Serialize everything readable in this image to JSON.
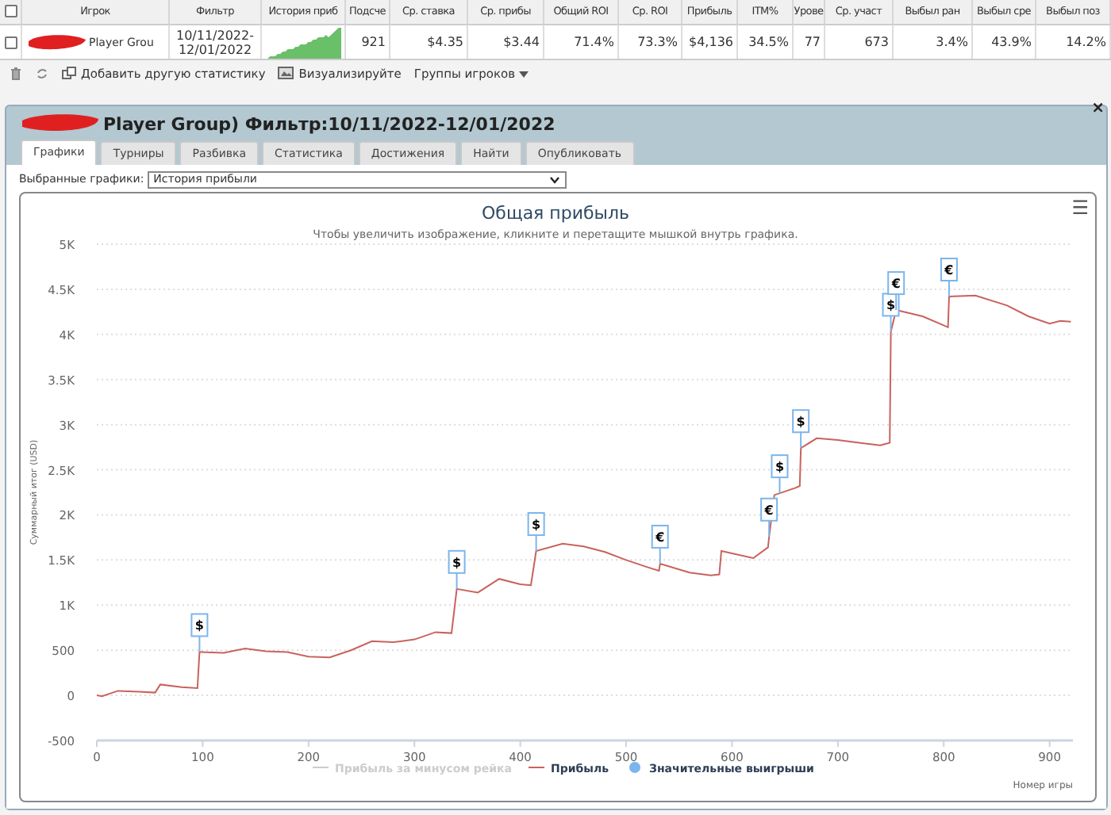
{
  "table": {
    "columns": [
      "Игрок",
      "Фильтр",
      "История приб",
      "Подсче",
      "Ср. ставка",
      "Ср. прибы",
      "Общий ROI",
      "Ср. ROI",
      "Прибыль",
      "ITM%",
      "Урове",
      "Ср. участ",
      "Выбыл ран",
      "Выбыл сре",
      "Выбыл поз"
    ],
    "header_checked": false,
    "rows": [
      {
        "checked": false,
        "cells": [
          "Player Grou",
          "10/11/2022-12/01/2022",
          null,
          "921",
          "$4.35",
          "$3.44",
          "71.4%",
          "73.3%",
          "$4,136",
          "34.5%",
          "77",
          "673",
          "3.4%",
          "43.9%",
          "14.2%"
        ]
      }
    ]
  },
  "toolbar": [
    {
      "kind": "delete"
    },
    {
      "kind": "refresh"
    },
    {
      "kind": "add",
      "label": "Добавить другую статистику"
    },
    {
      "kind": "visualize",
      "label": "Визуализируйте"
    },
    {
      "kind": "dropdown",
      "label": "Группы игроков"
    }
  ],
  "panel": {
    "title": "Player Group) Фильтр:10/11/2022-12/01/2022",
    "close": "×",
    "tabs": [
      {
        "label": "Графики",
        "selected": true
      },
      {
        "label": "Турниры",
        "selected": false
      },
      {
        "label": "Разбивка",
        "selected": false
      },
      {
        "label": "Статистика",
        "selected": false
      },
      {
        "label": "Достижения",
        "selected": false
      },
      {
        "label": "Найти",
        "selected": false
      },
      {
        "label": "Опубликовать",
        "selected": false
      }
    ],
    "chart_select": {
      "label": "Выбранные графики:",
      "value": "История прибыли"
    },
    "chart": {
      "menu": "☰",
      "legend": [
        {
          "label": "Прибыль за минусом рейка",
          "kind": "line",
          "hidden": true
        },
        {
          "kind": "series"
        },
        {
          "label": "Значительные выигрыши",
          "kind": "dot",
          "hidden": false
        }
      ],
      "chart_data": {
        "type": "line",
        "title": "Общая прибыль",
        "subtitle": "Чтобы увеличить изображение, кликните и перетащите мышкой внутрь графика.",
        "xlabel": "Номер игры",
        "ylabel": "Суммарный итог (USD)",
        "x": [
          0,
          5,
          20,
          40,
          55,
          60,
          80,
          95,
          97,
          120,
          140,
          160,
          180,
          200,
          220,
          240,
          260,
          280,
          300,
          320,
          335,
          340,
          360,
          380,
          400,
          410,
          415,
          440,
          460,
          480,
          500,
          520,
          531,
          532,
          560,
          580,
          588,
          590,
          620,
          634,
          635,
          640,
          660,
          664,
          665,
          680,
          700,
          720,
          740,
          749,
          750,
          755,
          780,
          800,
          804,
          805,
          830,
          860,
          880,
          900,
          910,
          920
        ],
        "series": [
          {
            "name": "Прибыль",
            "color": "#c9625c",
            "values": [
              0,
              -10,
              50,
              40,
              30,
              120,
              90,
              80,
              480,
              470,
              520,
              490,
              480,
              430,
              420,
              500,
              600,
              590,
              620,
              700,
              690,
              1180,
              1140,
              1290,
              1230,
              1220,
              1600,
              1680,
              1650,
              1590,
              1500,
              1420,
              1380,
              1460,
              1360,
              1330,
              1340,
              1600,
              1520,
              1640,
              1760,
              2220,
              2300,
              2320,
              2740,
              2850,
              2830,
              2800,
              2770,
              2800,
              4030,
              4270,
              4200,
              4100,
              4080,
              4420,
              4430,
              4320,
              4200,
              4120,
              4150,
              4140
            ]
          }
        ],
        "grid": true,
        "xlim": [
          0,
          922
        ],
        "ylim": [
          -500,
          5000
        ],
        "xticks": [
          0,
          100,
          200,
          300,
          400,
          500,
          600,
          700,
          800,
          900
        ],
        "yticks": [
          {
            "value": -500,
            "label": "-500"
          },
          {
            "value": 0,
            "label": "0"
          },
          {
            "value": 500,
            "label": "500"
          },
          {
            "value": 1000,
            "label": "1K"
          },
          {
            "value": 1500,
            "label": "1.5K"
          },
          {
            "value": 2000,
            "label": "2K"
          },
          {
            "value": 2500,
            "label": "2.5K"
          },
          {
            "value": 3000,
            "label": "3K"
          },
          {
            "value": 3500,
            "label": "3.5K"
          },
          {
            "value": 4000,
            "label": "4K"
          },
          {
            "value": 4500,
            "label": "4.5K"
          },
          {
            "value": 5000,
            "label": "5K"
          }
        ],
        "annotations": [
          {
            "x": 97,
            "y": 480,
            "text": "$"
          },
          {
            "x": 340,
            "y": 1180,
            "text": "$"
          },
          {
            "x": 415,
            "y": 1600,
            "text": "$"
          },
          {
            "x": 532,
            "y": 1460,
            "text": "€"
          },
          {
            "x": 635,
            "y": 1760,
            "text": "€"
          },
          {
            "x": 645,
            "y": 2240,
            "text": "$"
          },
          {
            "x": 665,
            "y": 2740,
            "text": "$"
          },
          {
            "x": 750,
            "y": 4030,
            "text": "$"
          },
          {
            "x": 755,
            "y": 4270,
            "text": "€"
          },
          {
            "x": 805,
            "y": 4420,
            "text": "€"
          }
        ]
      }
    }
  }
}
